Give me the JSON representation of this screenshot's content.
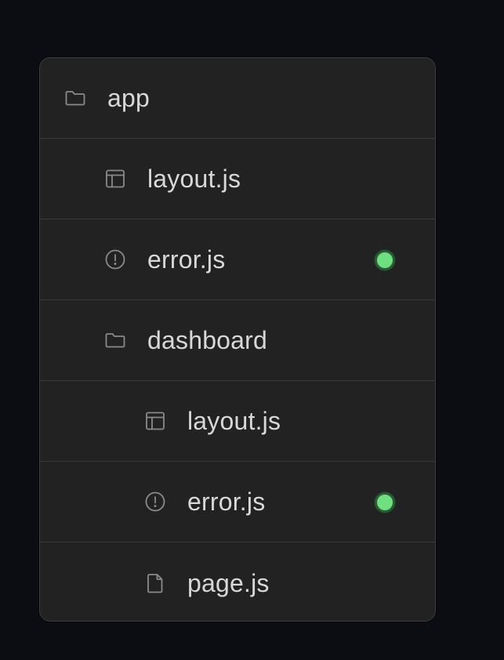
{
  "file_tree": {
    "items": [
      {
        "label": "app",
        "icon": "folder-icon",
        "depth": 0,
        "status": false
      },
      {
        "label": "layout.js",
        "icon": "layout-icon",
        "depth": 1,
        "status": false
      },
      {
        "label": "error.js",
        "icon": "error-icon",
        "depth": 1,
        "status": true
      },
      {
        "label": "dashboard",
        "icon": "folder-icon",
        "depth": 1,
        "status": false
      },
      {
        "label": "layout.js",
        "icon": "layout-icon",
        "depth": 2,
        "status": false
      },
      {
        "label": "error.js",
        "icon": "error-icon",
        "depth": 2,
        "status": true
      },
      {
        "label": "page.js",
        "icon": "file-icon",
        "depth": 2,
        "status": false
      }
    ],
    "status_color": "#6ee07f",
    "icon_color": "#8a8a8a",
    "text_color": "#d8d8d8"
  }
}
